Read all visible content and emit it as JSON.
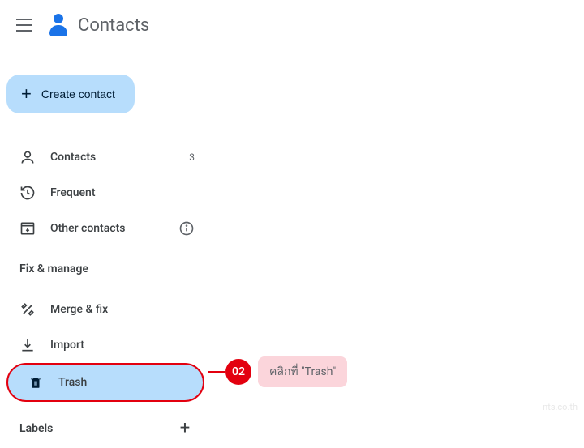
{
  "header": {
    "app_title": "Contacts"
  },
  "sidebar": {
    "create_label": "Create contact",
    "items": [
      {
        "label": "Contacts",
        "count": "3"
      },
      {
        "label": "Frequent"
      },
      {
        "label": "Other contacts"
      }
    ],
    "sections": {
      "fix_manage": "Fix & manage",
      "labels": "Labels"
    },
    "manage_items": [
      {
        "label": "Merge & fix"
      },
      {
        "label": "Import"
      },
      {
        "label": "Trash"
      }
    ]
  },
  "annotation": {
    "step": "02",
    "text": "คลิกที่ \"Trash\""
  },
  "watermark": "nts.co.th"
}
